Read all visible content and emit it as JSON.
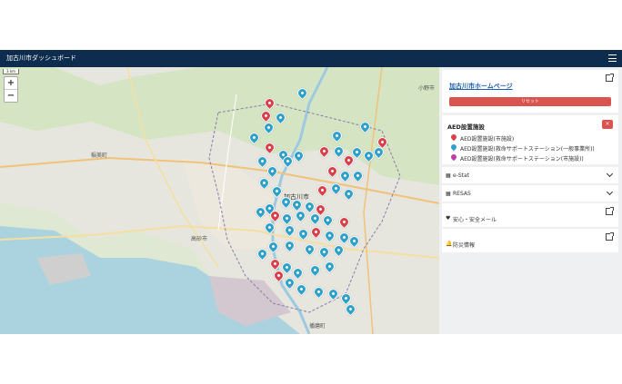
{
  "navbar": {
    "title": "加古川市ダッシュボード"
  },
  "map": {
    "scale_label": "3 km",
    "zoom_in": "+",
    "zoom_out": "−",
    "place_labels": [
      {
        "text": "小野市",
        "cls": "label"
      },
      {
        "text": "稲美町",
        "cls": "label"
      },
      {
        "text": "加古川市",
        "cls": "label big"
      },
      {
        "text": "高砂市",
        "cls": "label"
      },
      {
        "text": "播磨町",
        "cls": "label"
      }
    ]
  },
  "sidebar": {
    "homepage_link": "加古川市ホームページ",
    "reset_label": "リセット",
    "legend": {
      "title": "AED設置施設",
      "close": "×",
      "items": [
        {
          "label": "AED設置施設(市施設)",
          "color": "#d9414a"
        },
        {
          "label": "AED設置施設(救命サポートステーション(一般事業所))",
          "color": "#2ea0c9"
        },
        {
          "label": "AED設置施設(救命サポートステーション(市施設))",
          "color": "#c03da8"
        }
      ]
    },
    "rows": [
      {
        "icon": "table-icon",
        "label": "e-Stat"
      },
      {
        "icon": "table-icon",
        "label": "RESAS"
      },
      {
        "icon": "heart-icon",
        "label": "安心・安全メール"
      },
      {
        "icon": "bell-icon",
        "label": "防災情報"
      }
    ]
  },
  "colors": {
    "navbar": "#0d2c4e",
    "reset": "#d9534f",
    "marker_blue": "#2ea0c9",
    "marker_red": "#d9414a"
  }
}
